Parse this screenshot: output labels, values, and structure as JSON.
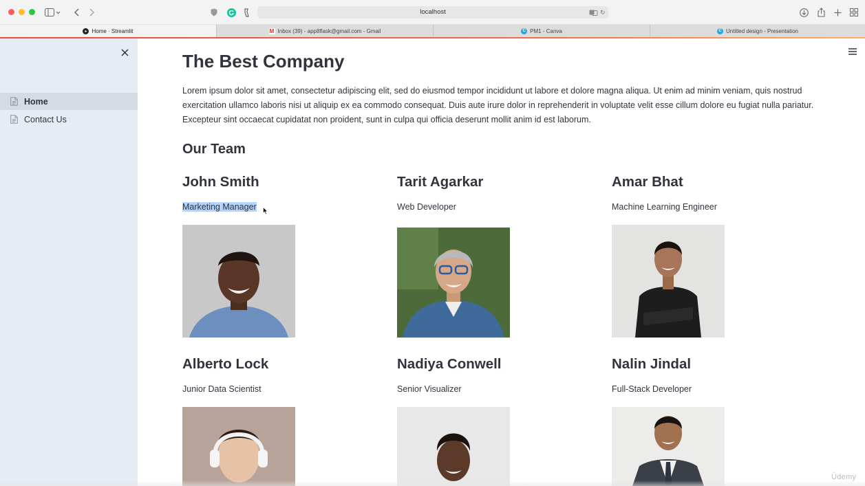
{
  "browser": {
    "url": "localhost",
    "tabs": [
      {
        "title": "Home · Streamlit",
        "icon": "streamlit-icon",
        "active": true
      },
      {
        "title": "Inbox (39) - app8flask@gmail.com - Gmail",
        "icon": "gmail-icon",
        "active": false
      },
      {
        "title": "PM1 - Canva",
        "icon": "canva-icon",
        "active": false
      },
      {
        "title": "Untitled design - Presentation",
        "icon": "canva-icon",
        "active": false
      }
    ],
    "accent_colors": {
      "close": "#ff5f57",
      "minimize": "#febc2e",
      "zoom": "#28c840"
    }
  },
  "sidebar": {
    "items": [
      {
        "label": "Home",
        "icon": "document-icon",
        "active": true
      },
      {
        "label": "Contact Us",
        "icon": "document-icon",
        "active": false
      }
    ]
  },
  "main": {
    "title": "The Best Company",
    "intro": "Lorem ipsum dolor sit amet, consectetur adipiscing elit, sed do eiusmod tempor incididunt ut labore et dolore magna aliqua. Ut enim ad minim veniam, quis nostrud exercitation ullamco laboris nisi ut aliquip ex ea commodo consequat. Duis aute irure dolor in reprehenderit in voluptate velit esse cillum dolore eu fugiat nulla pariatur. Excepteur sint occaecat cupidatat non proident, sunt in culpa qui officia deserunt mollit anim id est laborum.",
    "team_heading": "Our Team",
    "members": [
      {
        "name": "John Smith",
        "role": "Marketing Manager",
        "selected": true
      },
      {
        "name": "Tarit Agarkar",
        "role": "Web Developer",
        "selected": false
      },
      {
        "name": "Amar Bhat",
        "role": "Machine Learning Engineer",
        "selected": false
      },
      {
        "name": "Alberto Lock",
        "role": "Junior Data Scientist",
        "selected": false
      },
      {
        "name": "Nadiya Conwell",
        "role": "Senior Visualizer",
        "selected": false
      },
      {
        "name": "Nalin Jindal",
        "role": "Full-Stack Developer",
        "selected": false
      }
    ]
  },
  "watermark": "Ūdemy"
}
